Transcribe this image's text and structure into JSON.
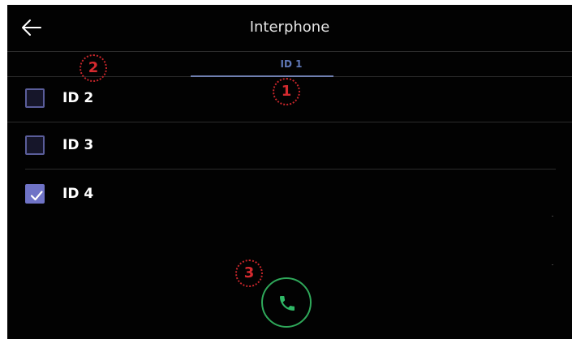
{
  "header": {
    "title": "Interphone",
    "back_icon": "arrow-left-icon"
  },
  "tabs": [
    {
      "label": "ID 1",
      "active": true
    }
  ],
  "list": [
    {
      "label": "ID 2",
      "checked": false
    },
    {
      "label": "ID 3",
      "checked": false
    },
    {
      "label": "ID 4",
      "checked": true
    }
  ],
  "call_button": {
    "icon": "phone-icon",
    "color": "#2fa85a"
  },
  "callouts": [
    "1",
    "2",
    "3"
  ],
  "colors": {
    "background": "#020202",
    "accent": "#6f73c6",
    "tab_text": "#5f78b8",
    "callout": "#d42a2f"
  }
}
